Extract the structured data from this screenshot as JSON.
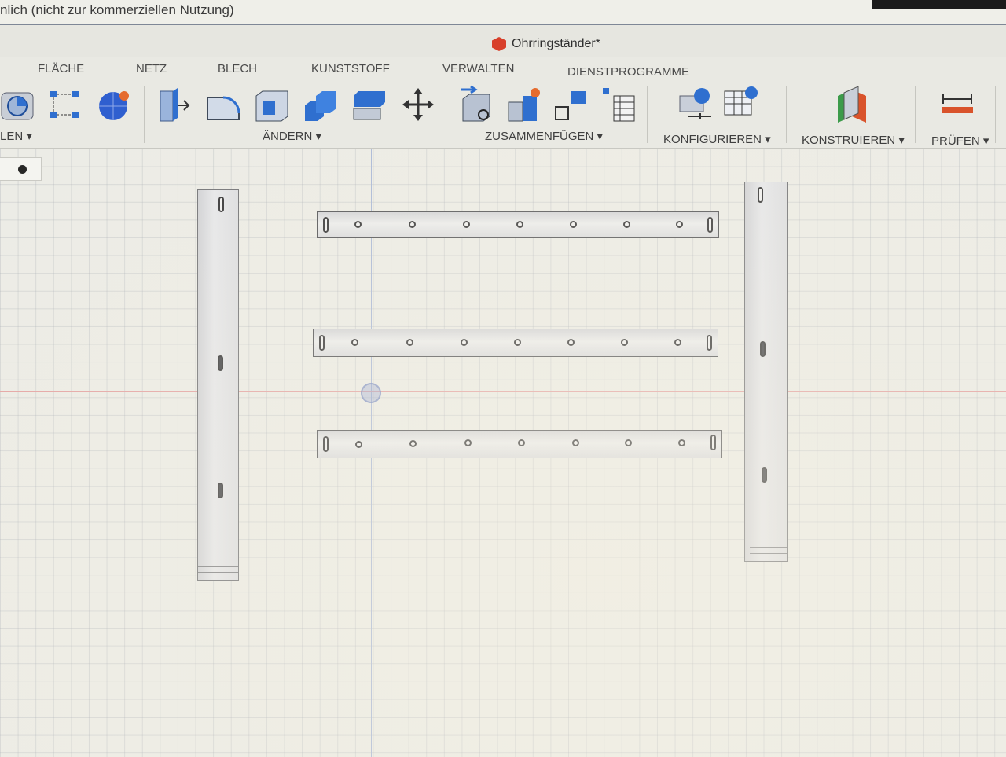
{
  "window": {
    "title_fragment": "nlich (nicht zur kommerziellen Nutzung)"
  },
  "document": {
    "title": "Ohrringständer*"
  },
  "toolbar": {
    "tabs": [
      "FLÄCHE",
      "NETZ",
      "BLECH",
      "KUNSTSTOFF",
      "VERWALTEN",
      "DIENSTPROGRAMME"
    ],
    "groups": [
      {
        "label": "LEN ▾"
      },
      {
        "label": "ÄNDERN ▾"
      },
      {
        "label": "ZUSAMMENFÜGEN ▾"
      },
      {
        "label": "KONFIGURIEREN ▾"
      },
      {
        "label": "KONSTRUIEREN ▾"
      },
      {
        "label": "PRÜFEN ▾"
      }
    ],
    "tool_icons": [
      "revolve-icon",
      "sketch-dimension-icon",
      "form-icon",
      "push-pull-icon",
      "fillet-icon",
      "shell-icon",
      "combine-icon",
      "replace-face-icon",
      "move-icon",
      "new-component-icon",
      "joint-icon",
      "as-built-joint-icon",
      "bill-of-materials-icon",
      "configure-icon",
      "configuration-table-icon",
      "construct-plane-icon",
      "measure-icon"
    ]
  },
  "colors": {
    "accent_blue": "#2f6fcf",
    "brand_red": "#d8402b",
    "axis_red": "#e3a0a0",
    "axis_blue": "#a5b5d6"
  }
}
